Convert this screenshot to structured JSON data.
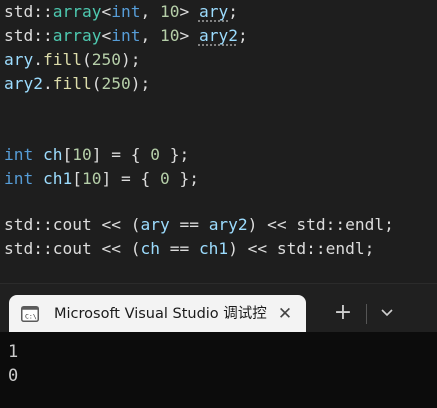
{
  "code": {
    "line1": {
      "ns": "std::",
      "tpl": "array",
      "lt": "<",
      "kw": "int",
      "mid": ", ",
      "num": "10",
      "gt": "> ",
      "var": "ary",
      "end": ";"
    },
    "line2": {
      "ns": "std::",
      "tpl": "array",
      "lt": "<",
      "kw": "int",
      "mid": ", ",
      "num": "10",
      "gt": "> ",
      "var": "ary2",
      "end": ";"
    },
    "line3": {
      "var": "ary",
      "dot": ".",
      "fn": "fill",
      "open": "(",
      "num": "250",
      "close": ");"
    },
    "line4": {
      "var": "ary2",
      "dot": ".",
      "fn": "fill",
      "open": "(",
      "num": "250",
      "close": ");"
    },
    "line7": {
      "kw": "int",
      "sp": " ",
      "var": "ch",
      "b1": "[",
      "num": "10",
      "b2": "] = { ",
      "num2": "0",
      "end": " };"
    },
    "line8": {
      "kw": "int",
      "sp": " ",
      "var": "ch1",
      "b1": "[",
      "num": "10",
      "b2": "] = { ",
      "num2": "0",
      "end": " };"
    },
    "line10": {
      "ns": "std::",
      "ident": "cout",
      "op": " << (",
      "a": "ary",
      "eq": " == ",
      "b": "ary2",
      "close": ") << ",
      "ns2": "std::",
      "endl": "endl",
      "end": ";"
    },
    "line11": {
      "ns": "std::",
      "ident": "cout",
      "op": " << (",
      "a": "ch",
      "eq": " == ",
      "b": "ch1",
      "close": ") << ",
      "ns2": "std::",
      "endl": "endl",
      "end": ";"
    }
  },
  "terminal": {
    "tab_title": "Microsoft Visual Studio 调试控",
    "close_glyph": "✕",
    "new_tab_glyph": "+",
    "output": [
      "1",
      "0"
    ]
  },
  "icons": {
    "tab_icon": "console-icon",
    "close": "close-icon",
    "new_tab": "plus-icon",
    "dropdown": "chevron-down-icon"
  }
}
